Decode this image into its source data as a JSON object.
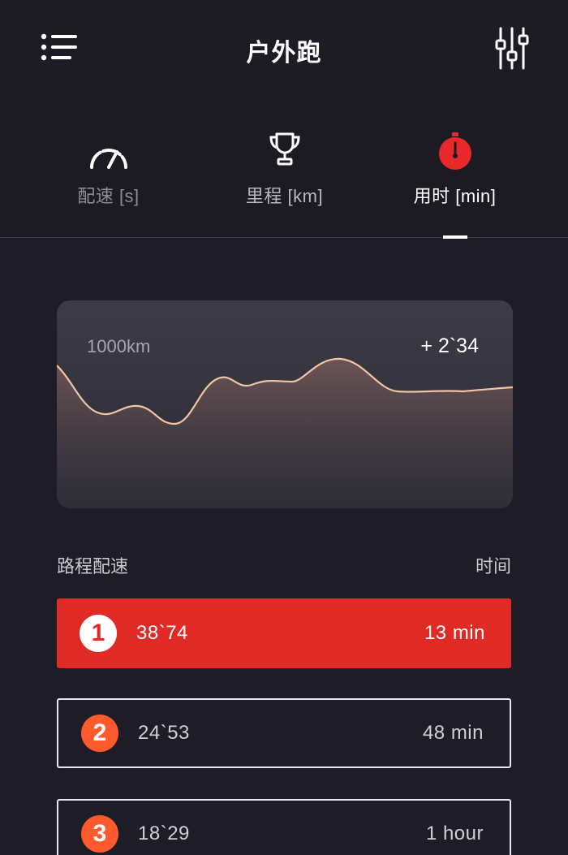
{
  "header": {
    "title": "户外跑",
    "menu_icon": "menu-list-icon",
    "filter_icon": "sliders-icon"
  },
  "tabs": [
    {
      "label": "配速 [s]",
      "icon": "speedometer-icon",
      "active": false
    },
    {
      "label": "里程 [km]",
      "icon": "trophy-icon",
      "active": false
    },
    {
      "label": "用时 [min]",
      "icon": "stopwatch-icon",
      "active": true
    }
  ],
  "chart": {
    "left_label": "1000km",
    "right_label": "+ 2`34"
  },
  "list_header": {
    "left": "路程配速",
    "right": "时间"
  },
  "rows": [
    {
      "rank": "1",
      "pace": "38`74",
      "time": "13 min",
      "active": true
    },
    {
      "rank": "2",
      "pace": "24`53",
      "time": "48 min",
      "active": false
    },
    {
      "rank": "3",
      "pace": "18`29",
      "time": "1 hour",
      "active": false
    }
  ],
  "colors": {
    "background": "#1e1d27",
    "accent_red": "#e02a26",
    "badge_orange": "#ff5a2e",
    "chart_line": "#f0c4a6"
  }
}
